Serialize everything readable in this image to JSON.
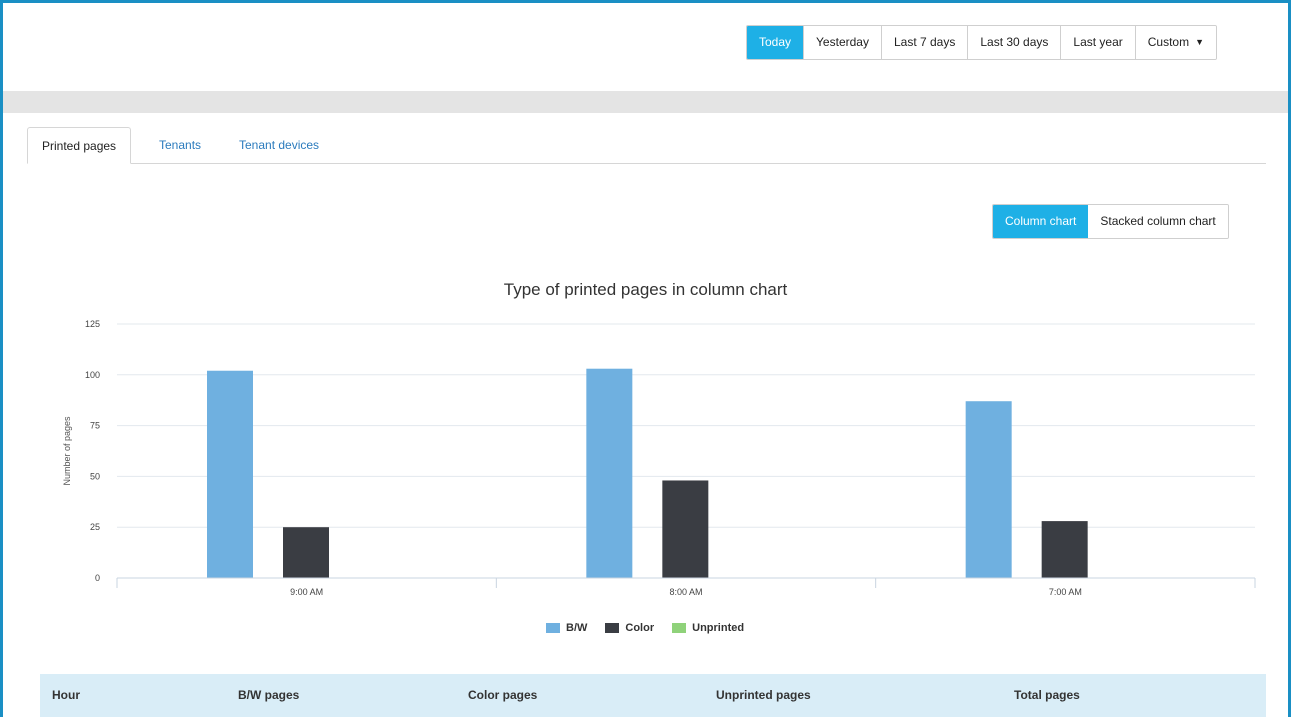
{
  "toolbar": {
    "ranges": [
      {
        "label": "Today",
        "active": true
      },
      {
        "label": "Yesterday",
        "active": false
      },
      {
        "label": "Last 7 days",
        "active": false
      },
      {
        "label": "Last 30 days",
        "active": false
      },
      {
        "label": "Last year",
        "active": false
      },
      {
        "label": "Custom",
        "active": false,
        "icon": "caret-down-icon"
      }
    ]
  },
  "tabs": [
    {
      "label": "Printed pages",
      "active": true
    },
    {
      "label": "Tenants",
      "active": false
    },
    {
      "label": "Tenant devices",
      "active": false
    }
  ],
  "chart_toggle": {
    "column_label": "Column chart",
    "stacked_label": "Stacked column chart",
    "active": "column"
  },
  "chart_data": {
    "type": "bar",
    "title": "Type of printed pages in column chart",
    "xlabel": "",
    "ylabel": "Number of pages",
    "ylim": [
      0,
      125
    ],
    "yticks": [
      0,
      25,
      50,
      75,
      100,
      125
    ],
    "categories": [
      "9:00 AM",
      "8:00 AM",
      "7:00 AM"
    ],
    "series": [
      {
        "name": "B/W",
        "color": "#6fb0e0",
        "values": [
          102,
          103,
          87
        ]
      },
      {
        "name": "Color",
        "color": "#3a3d43",
        "values": [
          25,
          48,
          28
        ]
      },
      {
        "name": "Unprinted",
        "color": "#8fd27a",
        "values": [
          0,
          0,
          0
        ]
      }
    ],
    "grid": true,
    "legend": "bottom-center"
  },
  "table": {
    "headers": [
      "Hour",
      "B/W pages",
      "Color pages",
      "Unprinted pages",
      "Total pages"
    ]
  },
  "colors": {
    "accent": "#1eb0e6",
    "link": "#2b7bbd",
    "table_header_bg": "#d9edf7"
  }
}
